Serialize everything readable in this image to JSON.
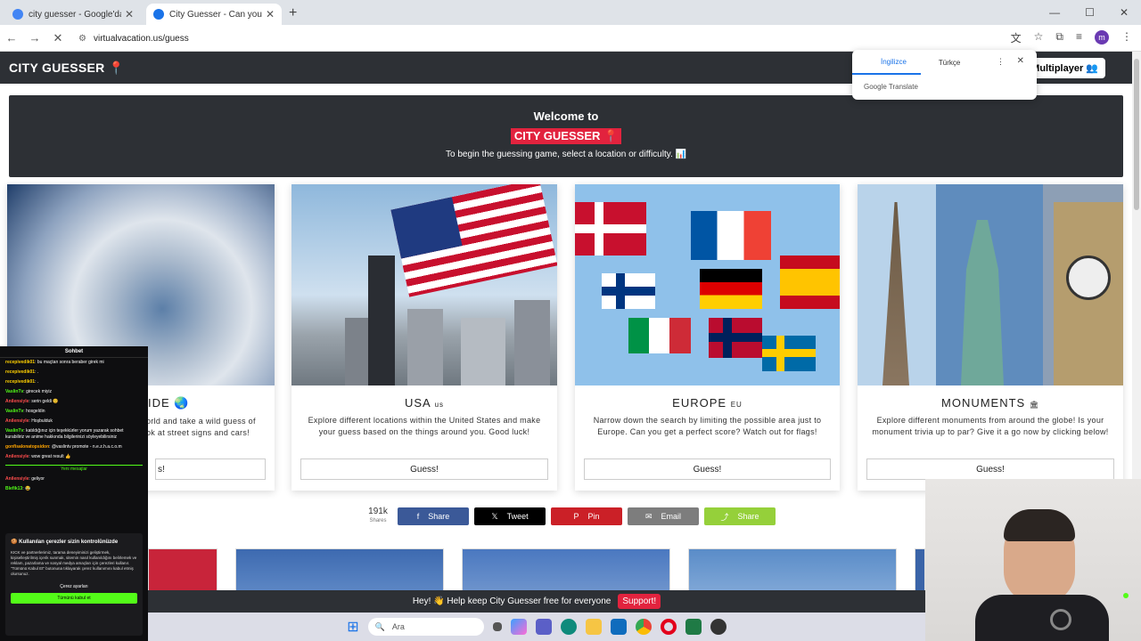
{
  "browser": {
    "tabs": [
      {
        "title": "city guesser - Google'da Ara",
        "favicon_color": "#4285f4"
      },
      {
        "title": "City Guesser - Can you guess w",
        "favicon_color": "#1a73e8"
      }
    ],
    "url": "virtualvacation.us/guess",
    "profile_initial": "m"
  },
  "site": {
    "logo": "CITY GUESSER",
    "multiplayer": "Multiplayer",
    "welcome_title": "Welcome to",
    "welcome_brand": "CITY GUESSER",
    "welcome_text": "To begin the guessing game, select a location or difficulty. 📊"
  },
  "cards": [
    {
      "title": "IDE",
      "desc": "orld and take a wild guess of\nok at street signs and cars!",
      "button": "s!"
    },
    {
      "title": "USA",
      "tag": "us",
      "desc": "Explore different locations within the United States and make your guess based on the things around you. Good luck!",
      "button": "Guess!"
    },
    {
      "title": "EUROPE",
      "tag": "EU",
      "desc": "Narrow down the search by limiting the possible area just to Europe. Can you get a perfect score? Watch out for flags!",
      "button": "Guess!"
    },
    {
      "title": "MONUMENTS",
      "tag": "🏛",
      "desc": "Explore different monuments from around the globe! Is your monument trivia up to par? Give it a go now by clicking below!",
      "button": "Guess!"
    }
  ],
  "shares": {
    "count": "191k",
    "count_label": "Shares",
    "buttons": [
      {
        "label": "Share",
        "icon": "f",
        "color": "#3b5998"
      },
      {
        "label": "Tweet",
        "icon": "𝕏",
        "color": "#000000"
      },
      {
        "label": "Pin",
        "icon": "P",
        "color": "#cb2027"
      },
      {
        "label": "Email",
        "icon": "✉",
        "color": "#7d7d7d"
      },
      {
        "label": "Share",
        "icon": "⤴",
        "color": "#95d03a"
      }
    ]
  },
  "support": {
    "text": "Hey! 👋 Help keep City Guesser free for everyone",
    "button": "Support!"
  },
  "translate": {
    "lang1": "İngilizce",
    "lang2": "Türkçe",
    "brand": "Google Translate"
  },
  "taskbar": {
    "search_placeholder": "Ara"
  },
  "chat": {
    "title": "Sohbet",
    "messages": [
      {
        "user": "recepivedik01",
        "text": "bu maçtan sonra beraber girek mi",
        "color": "#ffd000"
      },
      {
        "user": "recepivedik01",
        "text": ".",
        "color": "#ffd000"
      },
      {
        "user": "recepivedik01",
        "text": ".",
        "color": "#ffd000"
      },
      {
        "user": "VaslinTv",
        "text": "girecek miyiz",
        "color": "#53fc18"
      },
      {
        "user": "Anilensiyle",
        "text": "serin geldi 😊",
        "color": "#ff4d4d"
      },
      {
        "user": "VaslinTv",
        "text": "hosgeldin",
        "color": "#53fc18"
      },
      {
        "user": "Anilensiyle",
        "text": "Hoşbulduk",
        "color": "#ff4d4d"
      },
      {
        "user": "VaslinTv",
        "text": "katıldığınız için teşekkürler yorum yazarak sohbet kurabiliriz ve anime hakkında bilgilerinizi söyleyebilirsiniz",
        "color": "#53fc18"
      },
      {
        "user": "gonfisalonatopsidon",
        "text": "@vaslintv promote - n.e.z.h.a.c.o.m",
        "color": "#ffa500"
      },
      {
        "user": "Anilensiyle",
        "text": "wow great result 👍",
        "color": "#ff4d4d"
      }
    ],
    "new_messages": "Yeni mesajlar",
    "recent": [
      {
        "user": "Anilensiyle",
        "text": "geliyor",
        "color": "#ff4d4d"
      },
      {
        "user": "Blefik13",
        "text": "😂",
        "color": "#53fc18"
      }
    ],
    "cookie_title": "🍪 Kullanılan çerezler sizin kontrolünüzde",
    "cookie_text": "KICK ve partnerlerimiz, tarama deneyiminizi geliştirmek, kişiselleştirilmiş içerik sunmak, sitemin nasıl kullanıldığını belirlemek ve reklam, pazarlama ve sosyal medya amaçları için çerezleri kullanır. \"Tümünü Kabul Et\" butonuna tıklayarak çerez kullanımını kabul etmiş olursunuz.",
    "cookie_settings": "Çerez ayarları",
    "cookie_accept": "Tümünü kabul et"
  }
}
